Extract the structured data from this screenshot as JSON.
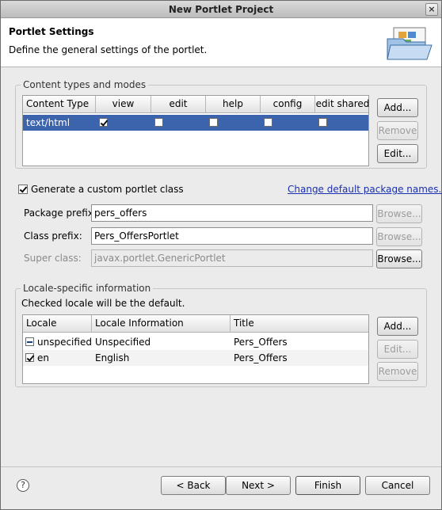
{
  "window": {
    "title": "New Portlet Project",
    "close_glyph": "×"
  },
  "header": {
    "title": "Portlet Settings",
    "description": "Define the general settings of the portlet.",
    "icon": "folder-wizard-icon"
  },
  "content_types": {
    "group_label": "Content types and modes",
    "columns": [
      "Content Type",
      "view",
      "edit",
      "help",
      "config",
      "edit shared"
    ],
    "rows": [
      {
        "content_type": "text/html",
        "view": true,
        "edit": false,
        "help": false,
        "config": false,
        "edit_shared": false,
        "selected": true
      }
    ],
    "buttons": {
      "add": "Add...",
      "remove": "Remove",
      "edit": "Edit..."
    }
  },
  "portlet_class": {
    "generate_label": "Generate a custom portlet class",
    "generate_checked": true,
    "change_link": "Change default package names...",
    "package_prefix_label": "Package prefix:",
    "package_prefix_value": "pers_offers",
    "class_prefix_label": "Class prefix:",
    "class_prefix_value": "Pers_OffersPortlet",
    "super_class_label": "Super class:",
    "super_class_value": "javax.portlet.GenericPortlet",
    "browse_label": "Browse..."
  },
  "locale": {
    "group_label": "Locale-specific information",
    "hint": "Checked locale will be the default.",
    "columns": [
      "Locale",
      "Locale Information",
      "Title"
    ],
    "rows": [
      {
        "locale": "unspecified",
        "info": "Unspecified",
        "title": "Pers_Offers",
        "state": "indeterminate"
      },
      {
        "locale": "en",
        "info": "English",
        "title": "Pers_Offers",
        "state": "checked"
      }
    ],
    "buttons": {
      "add": "Add...",
      "edit": "Edit...",
      "remove": "Remove"
    }
  },
  "footer": {
    "help": "?",
    "back": "< Back",
    "next": "Next >",
    "finish": "Finish",
    "cancel": "Cancel"
  }
}
